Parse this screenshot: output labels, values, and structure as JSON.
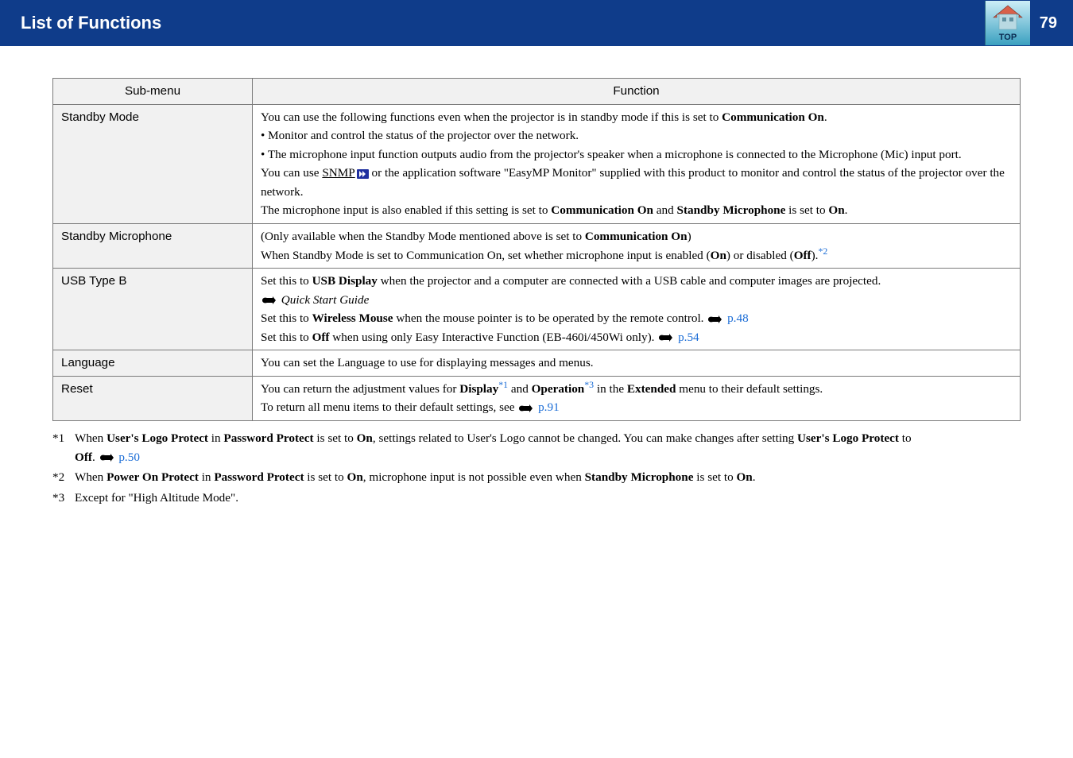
{
  "banner": {
    "title": "List of Functions",
    "page_number": "79",
    "top_label": "TOP"
  },
  "table": {
    "header_submenu": "Sub-menu",
    "header_function": "Function",
    "rows": {
      "standby_mode": {
        "label": "Standby Mode",
        "line1_a": "You can use the following functions even when the projector is in standby mode if this is set to ",
        "line1_b": "Communication On",
        "line1_c": ".",
        "bullet1": "• Monitor and control the status of the projector over the network.",
        "bullet2": "• The microphone input function outputs audio from the projector's speaker when a microphone is connected to the Microphone (Mic) input port.",
        "snmp_a": "You can use ",
        "snmp_link": "SNMP",
        "snmp_b": " or the application software \"EasyMP Monitor\" supplied with this product to monitor and control the status of the projector over the network.",
        "last_a": "The microphone input is also enabled if this setting is set to ",
        "last_b": "Communication On",
        "last_c": " and ",
        "last_d": "Standby Microphone",
        "last_e": " is set to ",
        "last_f": "On",
        "last_g": "."
      },
      "standby_mic": {
        "label": "Standby Microphone",
        "l1_a": "(Only available when the Standby Mode mentioned above is set to ",
        "l1_b": "Communication On",
        "l1_c": ")",
        "l2_a": "When Standby Mode is set to Communication On, set whether microphone input is enabled (",
        "l2_b": "On",
        "l2_c": ") or disabled (",
        "l2_d": "Off",
        "l2_e": ").",
        "sup": "*2"
      },
      "usb_b": {
        "label": "USB Type B",
        "l1_a": "Set this to ",
        "l1_b": "USB Display",
        "l1_c": " when the projector and a computer are connected with a USB cable and computer images are projected.",
        "qsg": "Quick Start Guide",
        "l3_a": "Set this to ",
        "l3_b": "Wireless Mouse",
        "l3_c": " when the mouse pointer is to be operated by the remote control. ",
        "l3_link": "p.48",
        "l4_a": "Set this to ",
        "l4_b": "Off",
        "l4_c": " when using only Easy Interactive Function (EB-460i/450Wi only). ",
        "l4_link": "p.54"
      },
      "language": {
        "label": "Language",
        "text": "You can set the Language to use for displaying messages and menus."
      },
      "reset": {
        "label": "Reset",
        "l1_a": "You can return the adjustment values for ",
        "l1_b": "Display",
        "l1_sup1": "*1",
        "l1_c": " and ",
        "l1_d": "Operation",
        "l1_sup2": "*3",
        "l1_e": " in the ",
        "l1_f": "Extended",
        "l1_g": " menu to their default settings.",
        "l2_a": "To return all menu items to their default settings, see ",
        "l2_link": "p.91"
      }
    }
  },
  "footnotes": {
    "f1": {
      "mark": "*1",
      "a": "When ",
      "b": "User's Logo Protect",
      "c": " in ",
      "d": "Password Protect",
      "e": " is set to ",
      "f": "On",
      "g": ", settings related to User's Logo cannot be changed. You can make changes after setting ",
      "h": "User's Logo Protect",
      "i": " to ",
      "j": "Off",
      "k": ". ",
      "link": "p.50"
    },
    "f2": {
      "mark": "*2",
      "a": "When ",
      "b": "Power On Protect",
      "c": " in ",
      "d": "Password Protect",
      "e": " is set to ",
      "f": "On",
      "g": ", microphone input is not possible even when ",
      "h": "Standby Microphone",
      "i": " is set to ",
      "j": "On",
      "k": "."
    },
    "f3": {
      "mark": "*3",
      "text": "Except for \"High Altitude Mode\"."
    }
  }
}
